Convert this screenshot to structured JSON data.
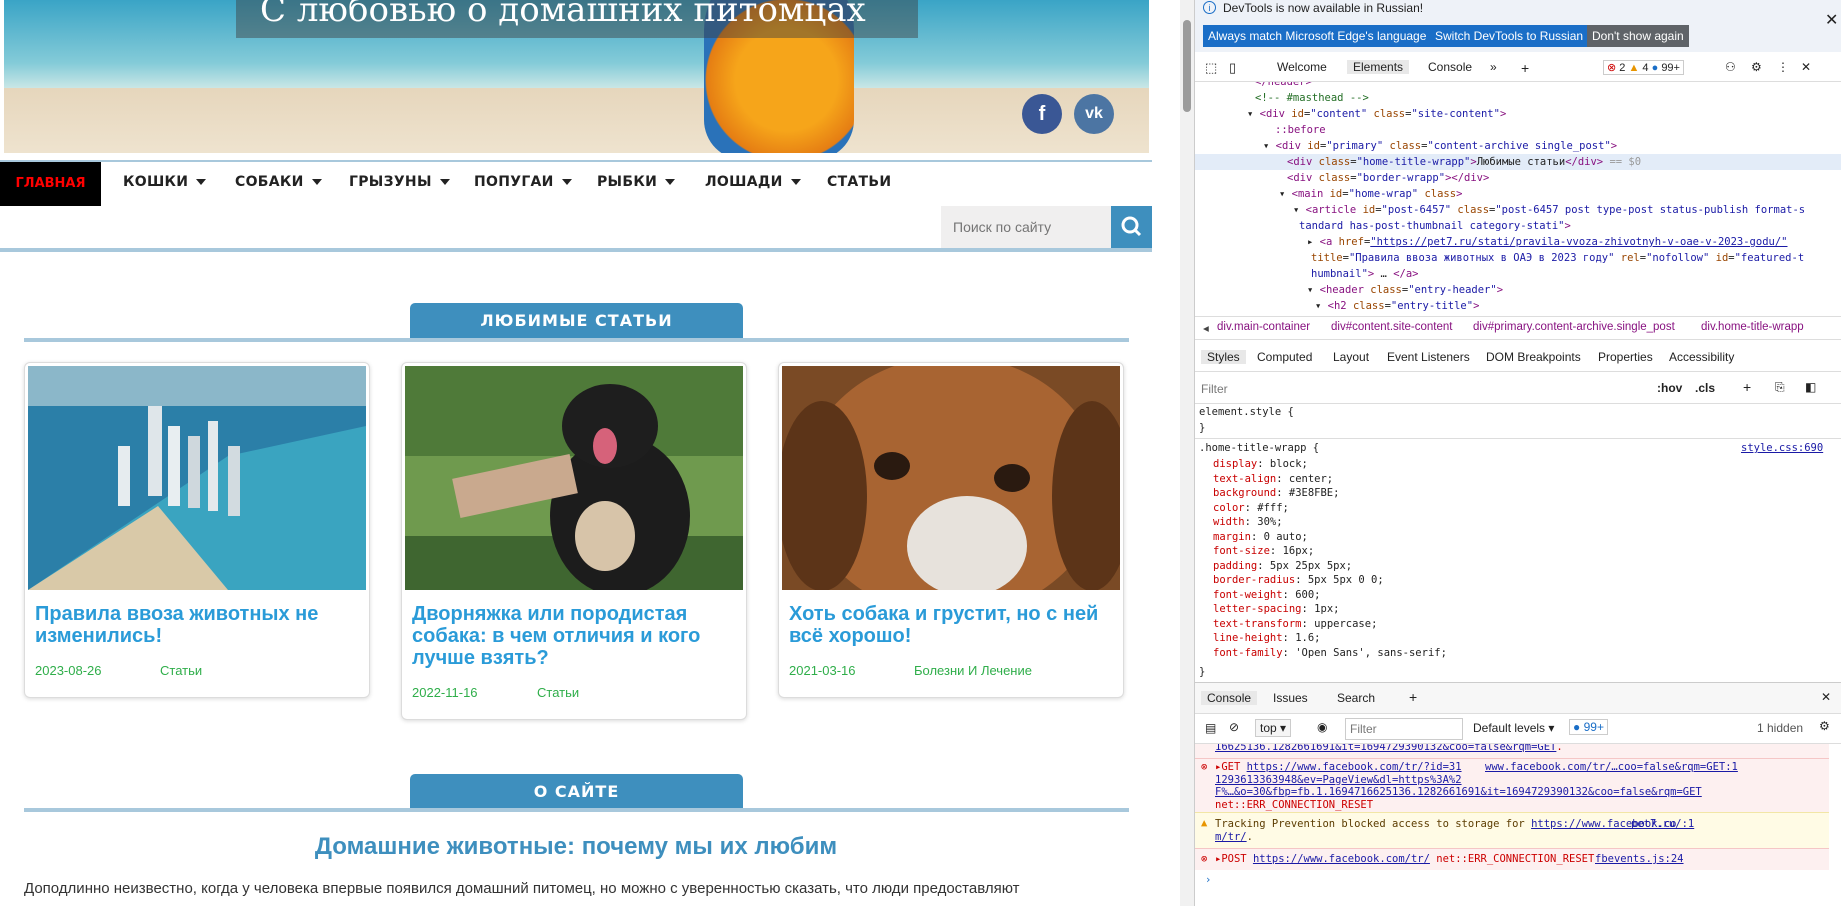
{
  "site": {
    "hero_title": "С любовью о домашних питомцах",
    "social": {
      "facebook": "f",
      "vk": "vk"
    },
    "nav": {
      "home": "ГЛАВНАЯ",
      "items": [
        "КОШКИ",
        "СОБАКИ",
        "ГРЫЗУНЫ",
        "ПОПУГАИ",
        "РЫБКИ",
        "ЛОШАДИ",
        "СТАТЬИ"
      ]
    },
    "search": {
      "placeholder": "Поиск по сайту"
    },
    "favorites_title": "ЛЮБИМЫЕ СТАТЬИ",
    "cards": [
      {
        "title": "Правила ввоза животных не изменились!",
        "date": "2023-08-26",
        "category": "Статьи"
      },
      {
        "title": "Дворняжка или породистая собака: в чем отличия и кого лучше взять?",
        "date": "2022-11-16",
        "category": "Статьи"
      },
      {
        "title": "Хоть собака и грустит, но с ней всё хорошо!",
        "date": "2021-03-16",
        "category": "Болезни И Лечение"
      }
    ],
    "about_title": "О САЙТЕ",
    "about_heading": "Домашние животные: почему мы их любим",
    "about_text": "Доподлинно  неизвестно, когда у человека впервые появился домашний питомец, но можно с уверенностью сказать, что люди предоставляют"
  },
  "devtools": {
    "info": "DevTools is now available in Russian!",
    "btn_match": "Always match Microsoft Edge's language",
    "btn_switch": "Switch DevTools to Russian",
    "btn_dont": "Don't show again",
    "tabs": [
      "Welcome",
      "Elements",
      "Console"
    ],
    "err_count": "2",
    "warn_count": "4",
    "msg_count": "99+",
    "breadcrumb": [
      "div.main-container",
      "div#content.site-content",
      "div#primary.content-archive.single_post",
      "div.home-title-wrapp"
    ],
    "subtabs": [
      "Styles",
      "Computed",
      "Layout",
      "Event Listeners",
      "DOM Breakpoints",
      "Properties",
      "Accessibility"
    ],
    "filter_placeholder": "Filter",
    "hov": ":hov",
    "cls": ".cls",
    "element_style": "element.style {",
    "rule_selector": ".home-title-wrapp {",
    "rule_source": "style.css:690",
    "props": [
      [
        "display",
        "block;"
      ],
      [
        "text-align",
        "center;"
      ],
      [
        "background",
        "#3E8FBE;"
      ],
      [
        "color",
        "#fff;"
      ],
      [
        "width",
        "30%;"
      ],
      [
        "margin",
        "0 auto;"
      ],
      [
        "font-size",
        "16px;"
      ],
      [
        "padding",
        "5px 25px 5px;"
      ],
      [
        "border-radius",
        "5px 5px 0 0;"
      ],
      [
        "font-weight",
        "600;"
      ],
      [
        "letter-spacing",
        "1px;"
      ],
      [
        "text-transform",
        "uppercase;"
      ],
      [
        "line-height",
        "1.6;"
      ],
      [
        "font-family",
        "'Open Sans', sans-serif;"
      ]
    ],
    "console_tabs": [
      "Console",
      "Issues",
      "Search"
    ],
    "context": "top",
    "console_filter": "Filter",
    "levels": "Default levels",
    "hidden": "1 hidden",
    "colors": {
      "accent": "#3E8FBE",
      "error": "#cc0000",
      "link": "#1a1aa6"
    }
  }
}
